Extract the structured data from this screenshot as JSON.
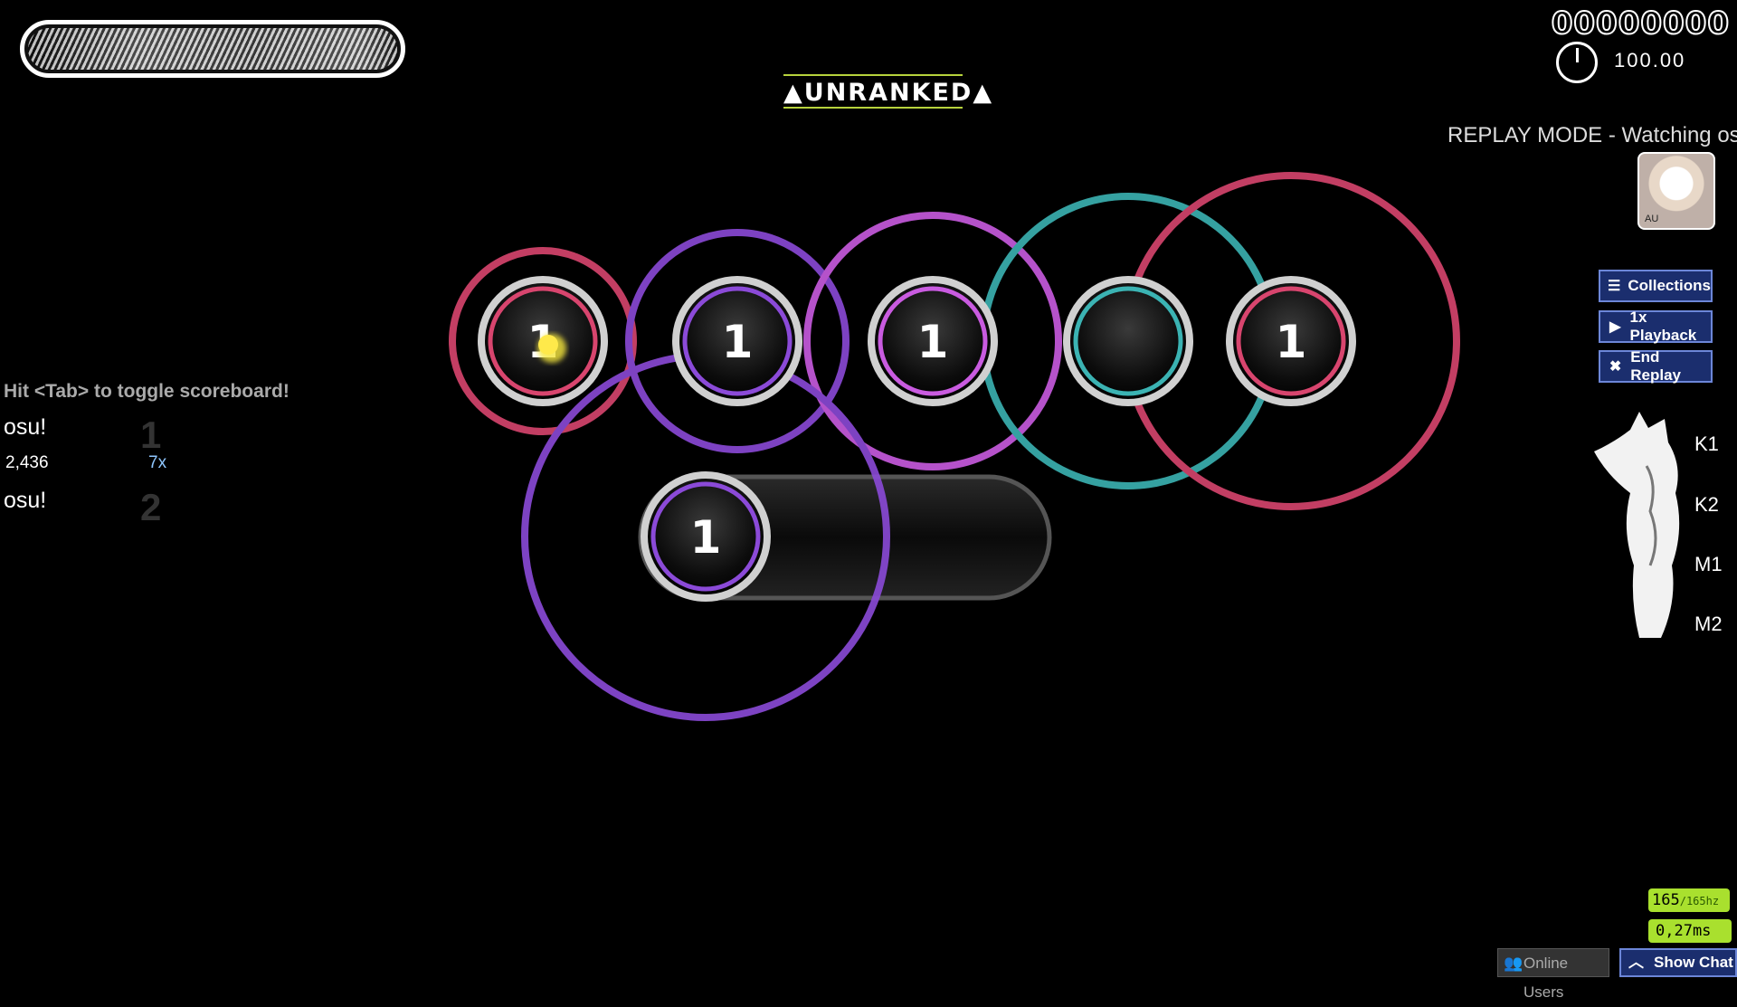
{
  "hud": {
    "score": "00000000",
    "accuracy": "100.00",
    "unranked_label": "UNRANKED",
    "replay_mode_text": "REPLAY MODE - Watching os",
    "avatar_label": "AU"
  },
  "side_buttons": [
    {
      "label": "Collections",
      "icon": "list-icon"
    },
    {
      "label": "1x Playback",
      "icon": "play-icon"
    },
    {
      "label": "End Replay",
      "icon": "close-icon"
    }
  ],
  "keys": [
    "K1",
    "K2",
    "M1",
    "M2"
  ],
  "scoreboard": {
    "hint": "Hit <Tab> to toggle scoreboard!",
    "entries": [
      {
        "name": "osu!",
        "rank": "1",
        "score": "2,436",
        "combo": "7x"
      },
      {
        "name": "osu!",
        "rank": "2"
      }
    ]
  },
  "hit_objects": [
    {
      "type": "circle",
      "combo_number": "1",
      "color": "#d8456e"
    },
    {
      "type": "circle",
      "combo_number": "1",
      "color": "#8b4ad8"
    },
    {
      "type": "circle",
      "combo_number": "1",
      "color": "#c95be0"
    },
    {
      "type": "circle",
      "combo_number": "",
      "color": "#3bb3b3"
    },
    {
      "type": "circle",
      "combo_number": "1",
      "color": "#d8456e"
    },
    {
      "type": "slider",
      "combo_number": "1",
      "color": "#8b4ad8"
    }
  ],
  "status": {
    "fps": "165",
    "fps_limit": "/165hz",
    "latency": "0,27ms",
    "online_users_label": "Online Users",
    "show_chat_label": "Show Chat"
  },
  "colors": {
    "accent_green": "#a9e02e",
    "button_blue": "#1b2e6e",
    "unranked_underline": "#b7d33c"
  }
}
